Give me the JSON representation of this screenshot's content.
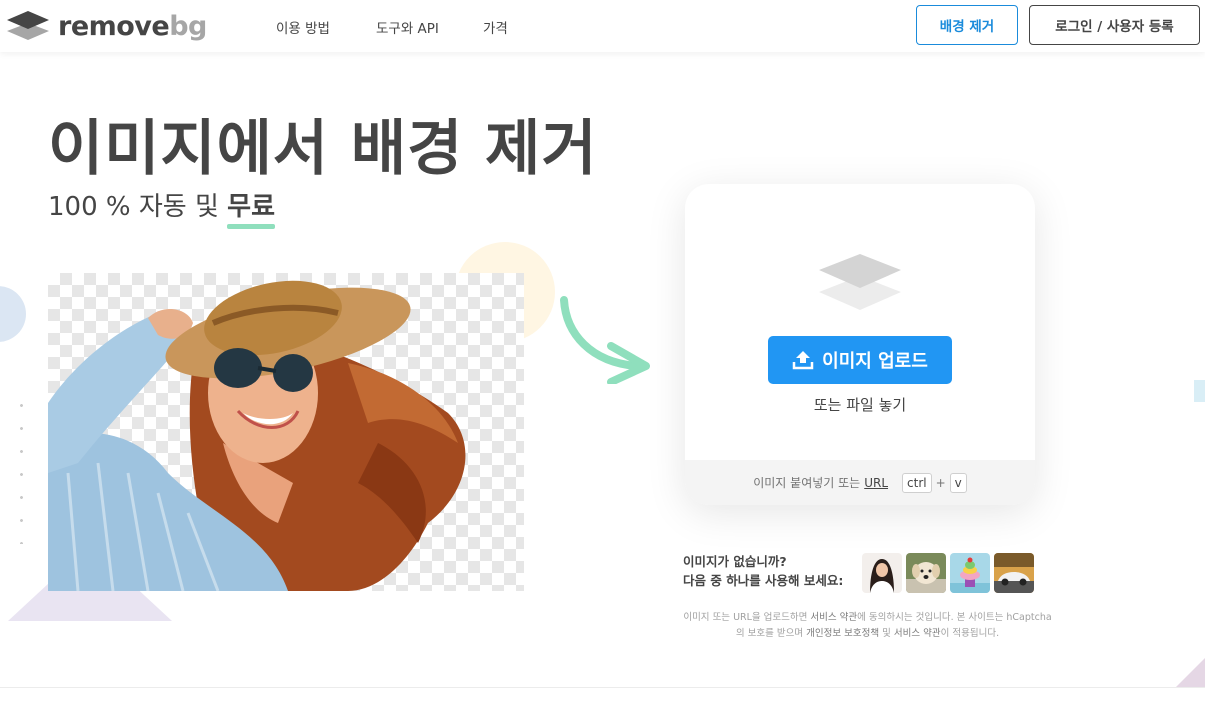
{
  "header": {
    "logo_main": "remove",
    "logo_accent": "bg",
    "nav": [
      "이용 방법",
      "도구와 API",
      "가격"
    ],
    "primary_button": "배경 제거",
    "login_button": "로그인 / 사용자 등록"
  },
  "hero": {
    "title": "이미지에서 배경 제거",
    "subtitle_prefix": "100 % 자동 및 ",
    "subtitle_highlight": "무료"
  },
  "upload": {
    "button_label": "이미지 업로드",
    "drop_text": "또는 파일 놓기",
    "paste_text": "이미지 붙여넣기 또는",
    "paste_url": "URL",
    "key_ctrl": "ctrl",
    "key_plus": "+",
    "key_v": "v"
  },
  "samples": {
    "line1": "이미지가 없습니까?",
    "line2": "다음 중 하나를 사용해 보세요:",
    "thumbnails": [
      "woman",
      "dog",
      "cake",
      "car"
    ]
  },
  "legal": {
    "text_1": "이미지 또는 URL을 업로드하면 ",
    "link_terms": "서비스 약관",
    "text_2": "에 동의하시는 것입니다. 본 사이트는 hCaptcha의 보호를 받으며 ",
    "link_privacy": "개인정보 보호정책",
    "text_3": " 및 ",
    "link_terms2": "서비스 약관",
    "text_4": "이 적용됩니다."
  },
  "colors": {
    "accent_blue": "#2196f3",
    "text_dark": "#454545",
    "highlight_green": "#8fdfbd"
  }
}
